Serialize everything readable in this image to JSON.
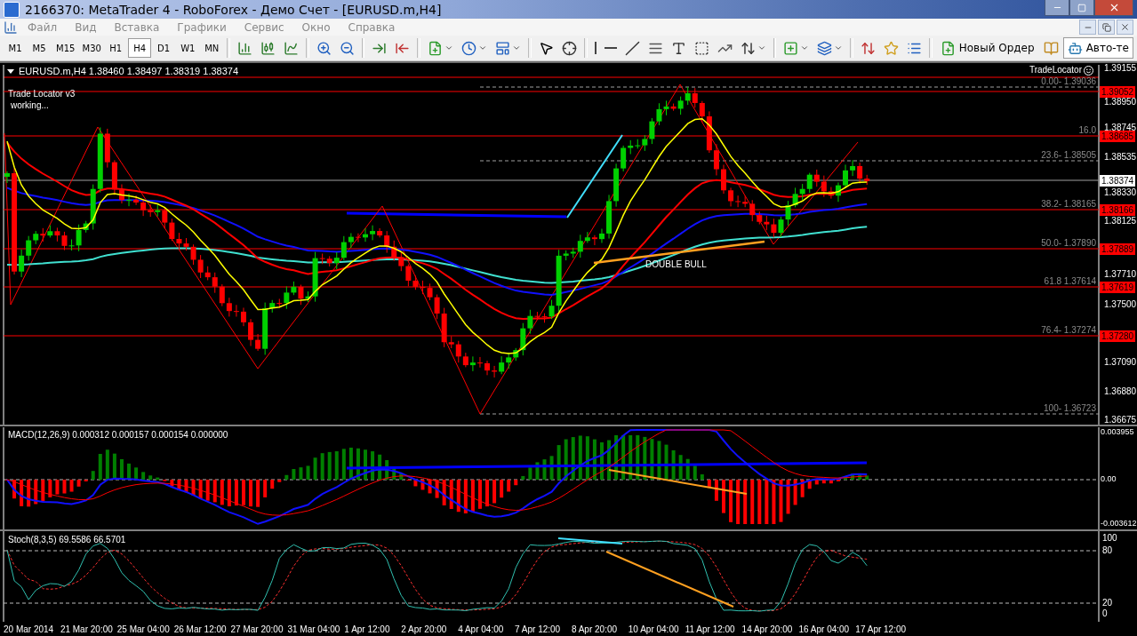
{
  "window": {
    "title": "2166370: MetaTrader 4 - RoboForex - Демо Счет - [EURUSD.m,H4]"
  },
  "menu": [
    "Файл",
    "Вид",
    "Вставка",
    "Графики",
    "Сервис",
    "Окно",
    "Справка"
  ],
  "timeframes": [
    {
      "label": "M1",
      "selected": false
    },
    {
      "label": "M5",
      "selected": false
    },
    {
      "label": "M15",
      "selected": false
    },
    {
      "label": "M30",
      "selected": false
    },
    {
      "label": "H1",
      "selected": false
    },
    {
      "label": "H4",
      "selected": true
    },
    {
      "label": "D1",
      "selected": false
    },
    {
      "label": "W1",
      "selected": false
    },
    {
      "label": "MN",
      "selected": false
    }
  ],
  "toolbar": {
    "new_order": "Новый Ордер",
    "auto_trading": "Авто-те"
  },
  "chart": {
    "header": "EURUSD.m,H4  1.38460 1.38497 1.38319 1.38374",
    "indicator_note": [
      "Trade Locator v3",
      "working..."
    ],
    "tradelocator_label": "TradeLocator",
    "pattern_label": "DOUBLE  BULL",
    "price_axis": [
      "1.39155",
      "1.38950",
      "1.38745",
      "1.38535",
      "1.38330",
      "1.38125",
      "1.37710",
      "1.37500",
      "1.37090",
      "1.36880",
      "1.36675"
    ],
    "levels": [
      {
        "kind": "dashed",
        "label": "0.00- 1.39036"
      },
      {
        "kind": "solid",
        "tag": "1.39052"
      },
      {
        "kind": "solid",
        "label": "16.0",
        "tag": "1.38685"
      },
      {
        "kind": "dashed",
        "label": "23.6- 1.38505"
      },
      {
        "kind": "current",
        "tag": "1.38374"
      },
      {
        "kind": "solid",
        "label": "38.2- 1.38165",
        "tag": "1.38166"
      },
      {
        "kind": "solid",
        "label": "50.0- 1.37890",
        "tag": "1.37889"
      },
      {
        "kind": "solid",
        "label": "61.8 1.37614",
        "tag": "1.37619"
      },
      {
        "kind": "solid",
        "label": "76.4- 1.37274",
        "tag": "1.37280"
      },
      {
        "kind": "dashed",
        "label": "100- 1.36723"
      }
    ]
  },
  "macd": {
    "label": "MACD(12,26,9) 0.000312 0.000157 0.000154 0.000000",
    "axis": [
      "0.003955",
      "0.00",
      "-0.003612"
    ]
  },
  "stoch": {
    "label": "Stoch(8,3,5) 69.5586 66.5701",
    "axis": [
      "100",
      "80",
      "20",
      "0"
    ]
  },
  "time_axis": [
    "20 Mar 2014",
    "21 Mar 20:00",
    "25 Mar 04:00",
    "26 Mar 12:00",
    "27 Mar 20:00",
    "31 Mar 04:00",
    "1 Apr 12:00",
    "2 Apr 20:00",
    "4 Apr 04:00",
    "7 Apr 12:00",
    "8 Apr 20:00",
    "10 Apr 04:00",
    "11 Apr 12:00",
    "14 Apr 20:00",
    "16 Apr 04:00",
    "17 Apr 12:00"
  ]
}
